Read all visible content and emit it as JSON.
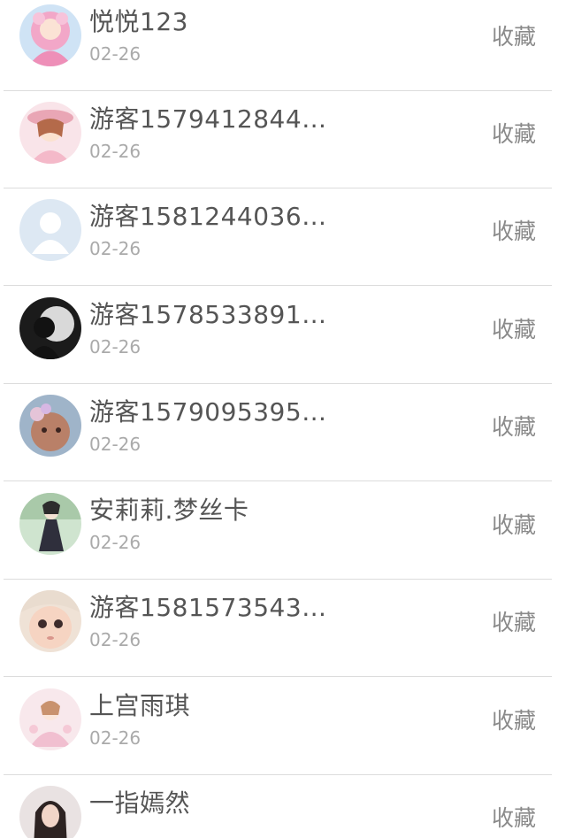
{
  "items": [
    {
      "name": "悦悦123",
      "date": "02-26",
      "action": "收藏",
      "avatar": "anime-pink-avatar-icon"
    },
    {
      "name": "游客1579412844…",
      "date": "02-26",
      "action": "收藏",
      "avatar": "anime-girl-hat-avatar-icon"
    },
    {
      "name": "游客1581244036…",
      "date": "02-26",
      "action": "收藏",
      "avatar": "default-user-avatar-icon"
    },
    {
      "name": "游客1578533891…",
      "date": "02-26",
      "action": "收藏",
      "avatar": "couple-silhouette-avatar-icon"
    },
    {
      "name": "游客1579095395…",
      "date": "02-26",
      "action": "收藏",
      "avatar": "face-photo-avatar-icon"
    },
    {
      "name": "安莉莉.梦丝卡",
      "date": "02-26",
      "action": "收藏",
      "avatar": "gothic-doll-avatar-icon"
    },
    {
      "name": "游客1581573543…",
      "date": "02-26",
      "action": "收藏",
      "avatar": "doll-face-avatar-icon"
    },
    {
      "name": "上宫雨琪",
      "date": "02-26",
      "action": "收藏",
      "avatar": "anime-flower-avatar-icon"
    },
    {
      "name": "一指嫣然",
      "date": "",
      "action": "收藏",
      "avatar": "portrait-photo-avatar-icon"
    }
  ]
}
